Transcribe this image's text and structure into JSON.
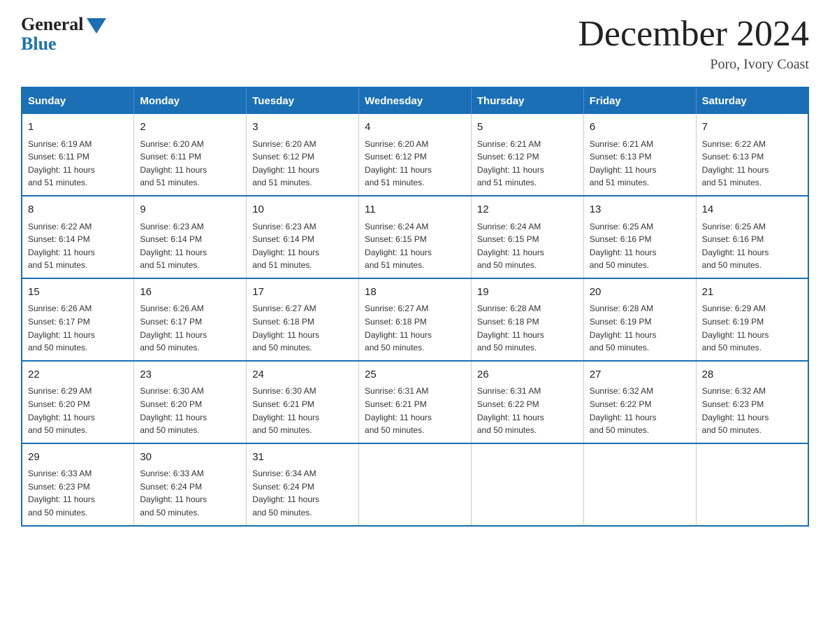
{
  "header": {
    "logo_general": "General",
    "logo_blue": "Blue",
    "month_title": "December 2024",
    "location": "Poro, Ivory Coast"
  },
  "days_of_week": [
    "Sunday",
    "Monday",
    "Tuesday",
    "Wednesday",
    "Thursday",
    "Friday",
    "Saturday"
  ],
  "weeks": [
    [
      {
        "day": "1",
        "sunrise": "6:19 AM",
        "sunset": "6:11 PM",
        "daylight": "11 hours and 51 minutes."
      },
      {
        "day": "2",
        "sunrise": "6:20 AM",
        "sunset": "6:11 PM",
        "daylight": "11 hours and 51 minutes."
      },
      {
        "day": "3",
        "sunrise": "6:20 AM",
        "sunset": "6:12 PM",
        "daylight": "11 hours and 51 minutes."
      },
      {
        "day": "4",
        "sunrise": "6:20 AM",
        "sunset": "6:12 PM",
        "daylight": "11 hours and 51 minutes."
      },
      {
        "day": "5",
        "sunrise": "6:21 AM",
        "sunset": "6:12 PM",
        "daylight": "11 hours and 51 minutes."
      },
      {
        "day": "6",
        "sunrise": "6:21 AM",
        "sunset": "6:13 PM",
        "daylight": "11 hours and 51 minutes."
      },
      {
        "day": "7",
        "sunrise": "6:22 AM",
        "sunset": "6:13 PM",
        "daylight": "11 hours and 51 minutes."
      }
    ],
    [
      {
        "day": "8",
        "sunrise": "6:22 AM",
        "sunset": "6:14 PM",
        "daylight": "11 hours and 51 minutes."
      },
      {
        "day": "9",
        "sunrise": "6:23 AM",
        "sunset": "6:14 PM",
        "daylight": "11 hours and 51 minutes."
      },
      {
        "day": "10",
        "sunrise": "6:23 AM",
        "sunset": "6:14 PM",
        "daylight": "11 hours and 51 minutes."
      },
      {
        "day": "11",
        "sunrise": "6:24 AM",
        "sunset": "6:15 PM",
        "daylight": "11 hours and 51 minutes."
      },
      {
        "day": "12",
        "sunrise": "6:24 AM",
        "sunset": "6:15 PM",
        "daylight": "11 hours and 50 minutes."
      },
      {
        "day": "13",
        "sunrise": "6:25 AM",
        "sunset": "6:16 PM",
        "daylight": "11 hours and 50 minutes."
      },
      {
        "day": "14",
        "sunrise": "6:25 AM",
        "sunset": "6:16 PM",
        "daylight": "11 hours and 50 minutes."
      }
    ],
    [
      {
        "day": "15",
        "sunrise": "6:26 AM",
        "sunset": "6:17 PM",
        "daylight": "11 hours and 50 minutes."
      },
      {
        "day": "16",
        "sunrise": "6:26 AM",
        "sunset": "6:17 PM",
        "daylight": "11 hours and 50 minutes."
      },
      {
        "day": "17",
        "sunrise": "6:27 AM",
        "sunset": "6:18 PM",
        "daylight": "11 hours and 50 minutes."
      },
      {
        "day": "18",
        "sunrise": "6:27 AM",
        "sunset": "6:18 PM",
        "daylight": "11 hours and 50 minutes."
      },
      {
        "day": "19",
        "sunrise": "6:28 AM",
        "sunset": "6:18 PM",
        "daylight": "11 hours and 50 minutes."
      },
      {
        "day": "20",
        "sunrise": "6:28 AM",
        "sunset": "6:19 PM",
        "daylight": "11 hours and 50 minutes."
      },
      {
        "day": "21",
        "sunrise": "6:29 AM",
        "sunset": "6:19 PM",
        "daylight": "11 hours and 50 minutes."
      }
    ],
    [
      {
        "day": "22",
        "sunrise": "6:29 AM",
        "sunset": "6:20 PM",
        "daylight": "11 hours and 50 minutes."
      },
      {
        "day": "23",
        "sunrise": "6:30 AM",
        "sunset": "6:20 PM",
        "daylight": "11 hours and 50 minutes."
      },
      {
        "day": "24",
        "sunrise": "6:30 AM",
        "sunset": "6:21 PM",
        "daylight": "11 hours and 50 minutes."
      },
      {
        "day": "25",
        "sunrise": "6:31 AM",
        "sunset": "6:21 PM",
        "daylight": "11 hours and 50 minutes."
      },
      {
        "day": "26",
        "sunrise": "6:31 AM",
        "sunset": "6:22 PM",
        "daylight": "11 hours and 50 minutes."
      },
      {
        "day": "27",
        "sunrise": "6:32 AM",
        "sunset": "6:22 PM",
        "daylight": "11 hours and 50 minutes."
      },
      {
        "day": "28",
        "sunrise": "6:32 AM",
        "sunset": "6:23 PM",
        "daylight": "11 hours and 50 minutes."
      }
    ],
    [
      {
        "day": "29",
        "sunrise": "6:33 AM",
        "sunset": "6:23 PM",
        "daylight": "11 hours and 50 minutes."
      },
      {
        "day": "30",
        "sunrise": "6:33 AM",
        "sunset": "6:24 PM",
        "daylight": "11 hours and 50 minutes."
      },
      {
        "day": "31",
        "sunrise": "6:34 AM",
        "sunset": "6:24 PM",
        "daylight": "11 hours and 50 minutes."
      },
      null,
      null,
      null,
      null
    ]
  ],
  "labels": {
    "sunrise": "Sunrise:",
    "sunset": "Sunset:",
    "daylight": "Daylight:"
  }
}
